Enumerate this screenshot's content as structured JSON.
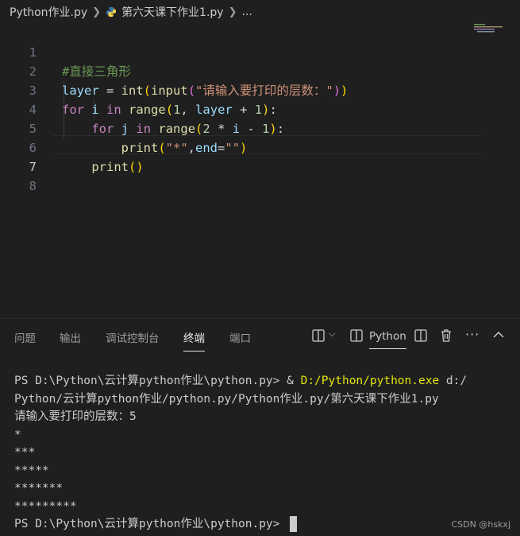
{
  "breadcrumb": {
    "folder": "Python作业.py",
    "file": "第六天课下作业1.py",
    "more": "..."
  },
  "editor": {
    "line_numbers": [
      "1",
      "2",
      "3",
      "4",
      "5",
      "6",
      "7",
      "8"
    ]
  },
  "panel": {
    "tabs": [
      "问题",
      "输出",
      "调试控制台",
      "终端",
      "端口"
    ],
    "terminal_name": "Python"
  },
  "terminal": {
    "lines": [
      "PS D:\\Python\\云计算python作业\\python.py> & ",
      "D:/Python/python.exe",
      " d:/",
      "Python/云计算python作业/python.py/Python作业.py/第六天课下作业1.py",
      "请输入要打印的层数：5",
      "*",
      "***",
      "*****",
      "*******",
      "*********",
      "PS D:\\Python\\云计算python作业\\python.py> "
    ]
  },
  "watermark": "CSDN @hskxj"
}
